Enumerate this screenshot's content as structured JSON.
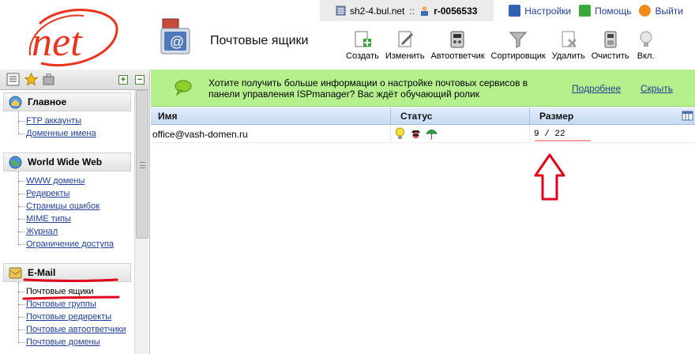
{
  "header": {
    "logo_text": "net",
    "server": "sh2-4.bul.net",
    "separator": "::",
    "user": "r-0056533",
    "links": {
      "settings": "Настройки",
      "help": "Помощь",
      "logout": "Выйти"
    },
    "page_title": "Почтовые ящики"
  },
  "toolbar": {
    "create": "Создать",
    "edit": "Изменить",
    "autoresponder": "Автоответчик",
    "sorter": "Сортировщик",
    "delete": "Удалить",
    "clear": "Очистить",
    "enable": "Вкл."
  },
  "sidebar": {
    "sections": [
      {
        "title": "Главное",
        "icon": "home-icon",
        "items": [
          "FTP аккаунты",
          "Доменные имена"
        ]
      },
      {
        "title": "World Wide Web",
        "icon": "globe-icon",
        "items": [
          "WWW домены",
          "Редиректы",
          "Страницы ошибок",
          "MIME типы",
          "Журнал",
          "Ограничение доступа"
        ]
      },
      {
        "title": "E-Mail",
        "icon": "envelope-icon",
        "items": [
          "Почтовые ящики",
          "Почтовые группы",
          "Почтовые редиректы",
          "Почтовые автоответчики",
          "Почтовые домены"
        ]
      }
    ]
  },
  "banner": {
    "text": "Хотите получить больше информации о настройке почтовых сервисов в панели управления ISPmanager? Вас ждёт обучающий ролик",
    "more": "Подробнее",
    "hide": "Скрыть"
  },
  "table": {
    "columns": [
      "Имя",
      "Статус",
      "Размер"
    ],
    "rows": [
      {
        "name": "office@vash-domen.ru",
        "status_icons": [
          "bulb-icon",
          "spy-icon",
          "umbrella-icon"
        ],
        "size": "9 / 22"
      }
    ]
  },
  "colors": {
    "banner_bg": "#b4f08c",
    "link": "#1f3f9c",
    "annotation_red": "#e0001a",
    "logo_red": "#e8351e"
  }
}
